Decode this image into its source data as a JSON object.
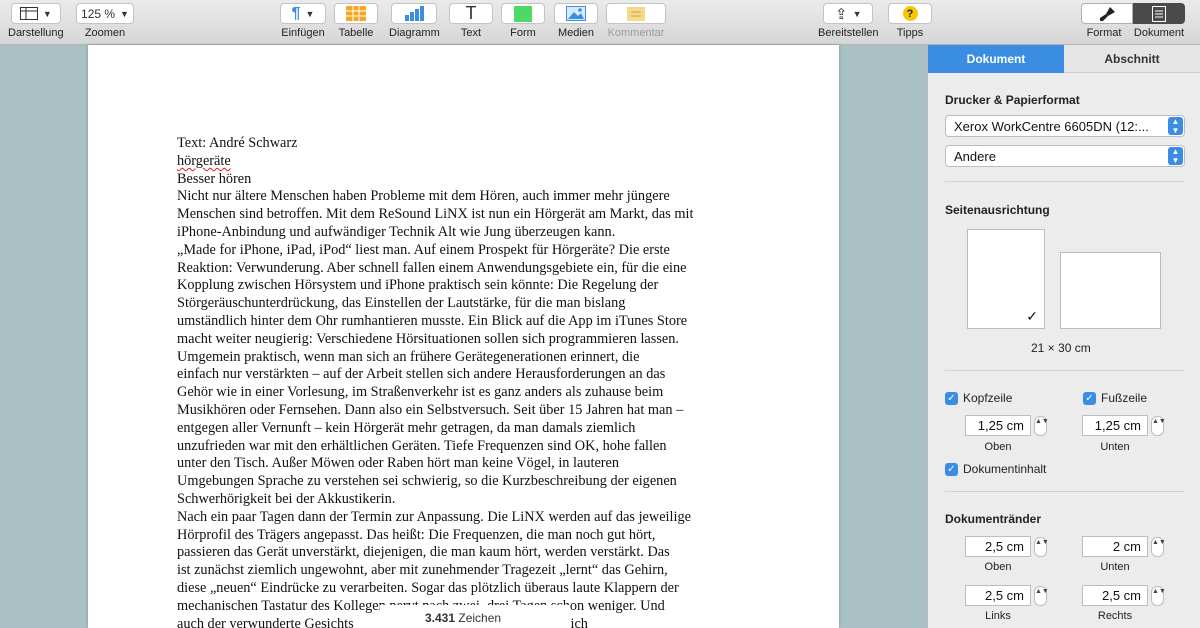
{
  "toolbar": {
    "view_label": "Darstellung",
    "zoom_value": "125 %",
    "zoom_label": "Zoomen",
    "insert_label": "Einfügen",
    "table_label": "Tabelle",
    "chart_label": "Diagramm",
    "text_label": "Text",
    "shape_label": "Form",
    "media_label": "Medien",
    "comment_label": "Kommentar",
    "share_label": "Bereitstellen",
    "tips_label": "Tipps",
    "tips_glyph": "?",
    "format_label": "Format",
    "document_label": "Dokument",
    "text_glyph": "T",
    "insert_glyph": "¶",
    "share_glyph": "⇪"
  },
  "colors": {
    "accent": "#3b8de4",
    "table_icon": "#f6a623",
    "shape_icon": "#4cd964",
    "tips_icon": "#f7c600",
    "canvas_bg": "#a9c0c4"
  },
  "document": {
    "lines": [
      "Text: André Schwarz",
      "hörgeräte",
      "Besser hören",
      "Nicht nur ältere Menschen haben Probleme mit dem Hören, auch immer mehr jüngere",
      "Menschen sind betroffen. Mit dem ReSound LiNX ist nun ein Hörgerät am Markt, das mit",
      "iPhone-Anbindung und aufwändiger Technik Alt wie Jung überzeugen kann.",
      "„Made for iPhone, iPad, iPod“ liest man. Auf einem Prospekt für Hörgeräte? Die erste",
      "Reaktion: Verwunderung. Aber schnell fallen einem Anwendungsgebiete ein, für die eine",
      "Kopplung zwischen Hörsystem und iPhone praktisch sein könnte: Die Regelung der",
      "Störgeräuschunterdrückung, das Einstellen der Lautstärke, für die man bislang",
      "umständlich hinter dem Ohr rumhantieren musste. Ein Blick auf die App im iTunes Store",
      "macht weiter neugierig: Verschiedene Hörsituationen sollen sich programmieren lassen.",
      "Umgemein praktisch, wenn man sich an frühere Gerätegenerationen erinnert, die",
      "einfach nur verstärkten – auf der Arbeit stellen sich andere Herausforderungen an das",
      "Gehör wie in einer Vorlesung, im Straßenverkehr ist es ganz anders als zuhause beim",
      "Musikhören oder Fernsehen. Dann also ein Selbstversuch. Seit über 15 Jahren hat man –",
      "entgegen aller Vernunft – kein Hörgerät mehr getragen, da man damals ziemlich",
      "unzufrieden war mit den erhältlichen Geräten. Tiefe Frequenzen sind OK, hohe fallen",
      "unter den Tisch. Außer Möwen oder Raben hört man keine Vögel, in lauteren",
      "Umgebungen Sprache zu verstehen sei schwierig, so die Kurzbeschreibung der eigenen",
      "Schwerhörigkeit bei der Akkustikerin.",
      "Nach ein paar Tagen dann der Termin zur Anpassung. Die LiNX werden auf das jeweilige",
      "Hörprofil des Trägers angepasst. Das heißt: Die Frequenzen, die man noch gut hört,",
      "passieren das Gerät unverstärkt, diejenigen, die man kaum hört, werden verstärkt. Das",
      "ist zunächst ziemlich ungewohnt, aber mit zunehmender Tragezeit „lernt“ das Gehirn,",
      "diese „neuen“ Eindrücke zu verarbeiten. Sogar das plötzlich überaus laute Klappern der",
      "mechanischen Tastatur des Kollegen nervt nach zwei, drei Tagen schon weniger. Und",
      "auch der verwunderte Gesichts                                h die Natur lässt sich"
    ]
  },
  "status": {
    "count_value": "3.431",
    "count_label": "Zeichen"
  },
  "inspector": {
    "tab_document": "Dokument",
    "tab_section": "Abschnitt",
    "printer_heading": "Drucker & Papierformat",
    "printer_value": "Xerox WorkCentre 6605DN (12:...",
    "paper_value": "Andere",
    "orientation_heading": "Seitenausrichtung",
    "paper_size": "21 × 30 cm",
    "header_label": "Kopfzeile",
    "footer_label": "Fußzeile",
    "header_value": "1,25 cm",
    "footer_value": "1,25 cm",
    "top_label": "Oben",
    "bottom_label": "Unten",
    "body_label": "Dokumentinhalt",
    "margins_heading": "Dokumentränder",
    "margin_top": "2,5 cm",
    "margin_bottom": "2 cm",
    "margin_left": "2,5 cm",
    "margin_right": "2,5 cm",
    "left_label": "Links",
    "right_label": "Rechts",
    "check_glyph": "✓",
    "stepper_glyph": "▲▼"
  }
}
